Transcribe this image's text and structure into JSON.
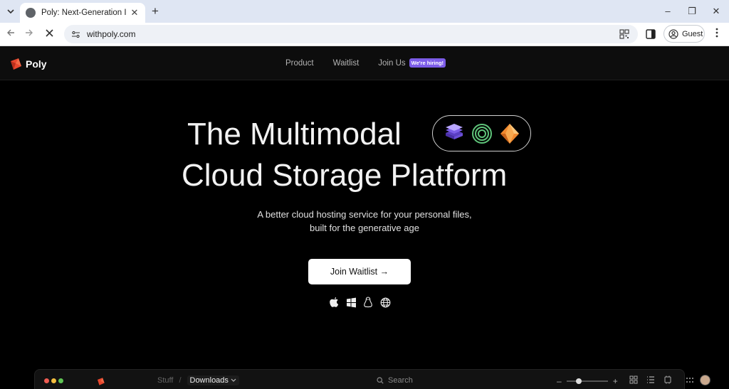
{
  "browser": {
    "tab_title": "Poly: Next-Generation Intelligen",
    "tab_close": "✕",
    "new_tab": "+",
    "url": "withpoly.com",
    "profile_label": "Guest",
    "window_controls": [
      "–",
      "❐",
      "✕"
    ]
  },
  "site": {
    "brand": "Poly",
    "nav": {
      "product": "Product",
      "waitlist": "Waitlist",
      "join_us": "Join Us",
      "hiring_badge": "We're hiring!"
    },
    "hero": {
      "line1": "The Multimodal",
      "line2": "Cloud Storage Platform",
      "subtitle": "A better cloud hosting service for your personal files, built for the generative age",
      "cta": "Join Waitlist →"
    },
    "platform_icons": [
      "apple-icon",
      "windows-icon",
      "linux-icon",
      "web-icon"
    ]
  },
  "app_preview": {
    "breadcrumb_parent": "Stuff",
    "breadcrumb_separator": "/",
    "breadcrumb_current": "Downloads",
    "search_placeholder": "Search",
    "zoom_minus": "–",
    "zoom_plus": "+",
    "zoom_level": 0.3
  },
  "colors": {
    "accent_purple": "#7c5ce8",
    "brand_red": "#e8472e",
    "page_bg": "#000000"
  }
}
